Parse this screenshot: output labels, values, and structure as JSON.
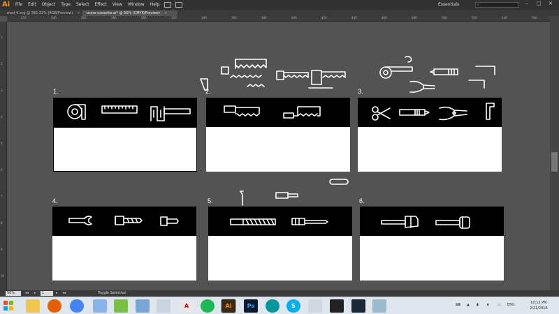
{
  "app": {
    "logo": "Ai",
    "menu": [
      "File",
      "Edit",
      "Object",
      "Type",
      "Select",
      "Effect",
      "View",
      "Window",
      "Help"
    ],
    "workspace": "Essentials",
    "window_controls": [
      "–",
      "□",
      "✕"
    ]
  },
  "tabs": [
    {
      "label": "mod-4.svg @ 382.32% (RGB/Preview)",
      "active": false
    },
    {
      "label": "icone-cassette.ai* @ 50% (CMYK/Preview)",
      "active": true
    }
  ],
  "ruler": {
    "top_labels": [
      "220",
      "240",
      "260",
      "280",
      "300",
      "320",
      "340",
      "360",
      "380",
      "400",
      "420",
      "440",
      "460",
      "480",
      "500",
      "520",
      "540",
      "560"
    ],
    "left_labels": [
      "1",
      "2",
      "3",
      "4",
      "5",
      "6",
      "7",
      "8",
      "9",
      "10"
    ]
  },
  "cards": [
    {
      "num": "1.",
      "tools": [
        "tape-measure",
        "ruler",
        "caliper"
      ]
    },
    {
      "num": "2.",
      "tools": [
        "hand-saw",
        "hacksaw"
      ]
    },
    {
      "num": "3.",
      "tools": [
        "scissors",
        "utility-knife",
        "pliers",
        "allen-key"
      ]
    },
    {
      "num": "4.",
      "tools": [
        "wrench",
        "drill-bit",
        "screwdriver-short"
      ]
    },
    {
      "num": "5.",
      "tools": [
        "file",
        "screwdriver"
      ]
    },
    {
      "num": "6.",
      "tools": [
        "hammer",
        "mallet"
      ]
    }
  ],
  "status": {
    "zoom": "50%",
    "page": "1",
    "text": "Toggle Selection"
  },
  "taskbar": {
    "apps": [
      "Windows",
      "File Explorer",
      "Firefox",
      "Chrome",
      "Paint",
      "Notepad++",
      "Explorer",
      "Folder",
      "Documents",
      "Acrobat",
      "Spotify",
      "Illustrator",
      "Photoshop",
      "Arduino",
      "Skype",
      "Inkscape",
      "Unity",
      "Steam",
      "Tool"
    ],
    "tray_lang": "ENG",
    "time": "10:12 PM",
    "date": "2/21/2016"
  },
  "colors": {
    "menubar": "#323232",
    "canvas": "#535353",
    "accent": "#f7941d"
  }
}
